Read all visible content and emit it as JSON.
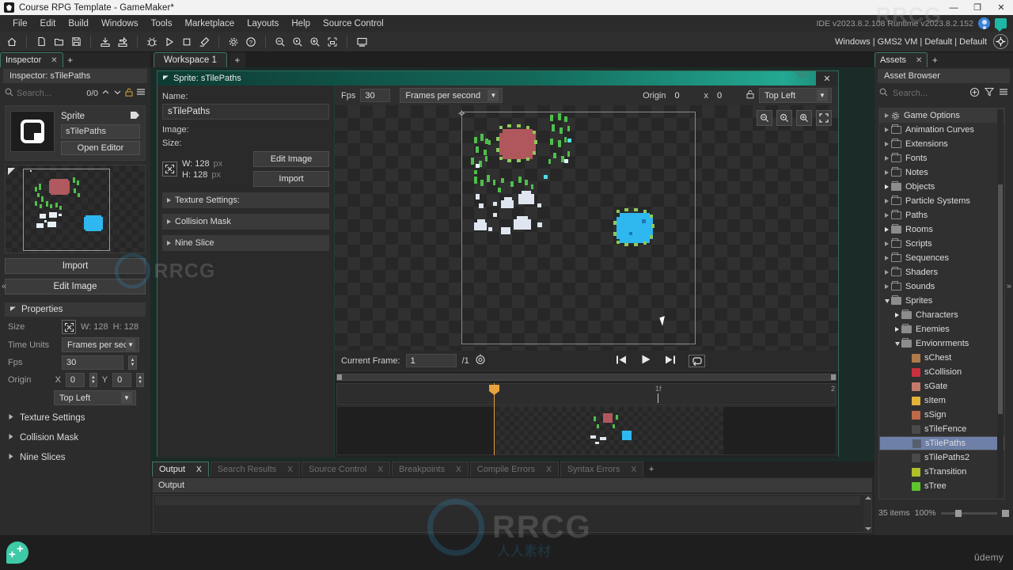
{
  "titlebar": {
    "title": "Course RPG Template - GameMaker*",
    "app_icon": "gamemaker-icon",
    "minimize": "—",
    "maximize": "❐",
    "close": "✕"
  },
  "menubar": {
    "items": [
      "File",
      "Edit",
      "Build",
      "Windows",
      "Tools",
      "Marketplace",
      "Layouts",
      "Help",
      "Source Control"
    ],
    "version_text": "IDE v2023.8.2.108  Runtime v2023.8.2.152"
  },
  "toolbar": {
    "icons": [
      "home-icon",
      "new-file-icon",
      "open-folder-icon",
      "save-icon",
      "build-icon",
      "build-run-icon",
      "debug-icon",
      "play-icon",
      "stop-icon",
      "clean-icon",
      "preferences-gear-icon",
      "help-icon",
      "zoom-out-icon",
      "zoom-reset-icon",
      "zoom-in-icon",
      "zoom-fit-icon",
      "display-icon"
    ],
    "target": "Windows | GMS2 VM | Default | Default",
    "target_button": "target-selector-icon"
  },
  "inspector": {
    "tab_label": "Inspector",
    "tab_close": "✕",
    "tab_add": "+",
    "panel_title": "Inspector: sTilePaths",
    "search_placeholder": "Search...",
    "match_count": "0/0",
    "up_icon": "chevron-up-icon",
    "down_icon": "chevron-down-icon",
    "lock_icon": "unlock-icon",
    "menu_icon": "hamburger-menu-icon",
    "card": {
      "type_label": "Sprite",
      "tag_icon": "tag-icon",
      "name_value": "sTilePaths",
      "open_editor_label": "Open Editor"
    },
    "import_label": "Import",
    "edit_image_label": "Edit Image",
    "properties": {
      "section_label": "Properties",
      "size_label": "Size",
      "size_icon": "resize-icon",
      "width_text": "W: 128",
      "height_text": "H: 128",
      "time_units_label": "Time Units",
      "time_units_value": "Frames per secon",
      "fps_label": "Fps",
      "fps_value": "30",
      "origin_label": "Origin",
      "origin_x_label": "X",
      "origin_x_value": "0",
      "origin_y_label": "Y",
      "origin_y_value": "0",
      "origin_preset": "Top Left"
    },
    "sections": [
      "Texture Settings",
      "Collision Mask",
      "Nine Slices"
    ],
    "collapse_icon": "«"
  },
  "workspace": {
    "tab_label": "Workspace 1",
    "tab_add": "+"
  },
  "sprite_editor": {
    "header_title": "Sprite: sTilePaths",
    "close_icon": "✕",
    "name_label": "Name:",
    "name_value": "sTilePaths",
    "image_label": "Image:",
    "size_label": "Size:",
    "size_icon": "resize-icon",
    "width_text": "W: 128",
    "height_text": "H: 128",
    "px_unit": "px",
    "edit_image_label": "Edit Image",
    "import_label": "Import",
    "accordions": [
      "Texture Settings:",
      "Collision Mask",
      "Nine Slice"
    ],
    "toolbar": {
      "fps_label": "Fps",
      "fps_value": "30",
      "time_units_value": "Frames per second",
      "origin_label": "Origin",
      "origin_x_value": "0",
      "origin_sep": "x",
      "origin_y_value": "0",
      "lock_icon": "unlock-icon",
      "origin_preset": "Top Left"
    },
    "canvas_tools": [
      "zoom-out-icon",
      "zoom-reset-icon",
      "zoom-in-icon",
      "fit-to-window-icon"
    ],
    "frame_bar": {
      "current_frame_label": "Current Frame:",
      "current_frame_value": "1",
      "total_frames": "/1",
      "onion_skin_icon": "onion-skin-icon",
      "first_frame_icon": "skip-back-icon",
      "play_icon": "play-icon",
      "last_frame_icon": "skip-forward-icon",
      "loop_icon": "loop-icon"
    },
    "timeline": {
      "tick_start": "0f",
      "tick_mid": "1f",
      "tick_end": "2"
    }
  },
  "output": {
    "tabs": [
      {
        "label": "Output",
        "active": true
      },
      {
        "label": "Search Results",
        "active": false
      },
      {
        "label": "Source Control",
        "active": false
      },
      {
        "label": "Breakpoints",
        "active": false
      },
      {
        "label": "Compile Errors",
        "active": false
      },
      {
        "label": "Syntax Errors",
        "active": false
      }
    ],
    "tab_close": "X",
    "tab_add": "+",
    "subtitle": "Output"
  },
  "assets": {
    "tab_label": "Assets",
    "tab_close": "✕",
    "tab_add": "+",
    "panel_title": "Asset Browser",
    "search_placeholder": "Search...",
    "add_icon": "add-circle-icon",
    "filter_icon": "filter-icon",
    "menu_icon": "hamburger-menu-icon",
    "tree": [
      {
        "label": "Game Options",
        "depth": 0,
        "arrow": "closed",
        "icon": "gear",
        "header": true
      },
      {
        "label": "Animation Curves",
        "depth": 0,
        "arrow": "closed",
        "icon": "folder"
      },
      {
        "label": "Extensions",
        "depth": 0,
        "arrow": "closed",
        "icon": "folder"
      },
      {
        "label": "Fonts",
        "depth": 0,
        "arrow": "closed",
        "icon": "folder"
      },
      {
        "label": "Notes",
        "depth": 0,
        "arrow": "closed",
        "icon": "folder"
      },
      {
        "label": "Objects",
        "depth": 0,
        "arrow": "closed-filled",
        "icon": "folder-full"
      },
      {
        "label": "Particle Systems",
        "depth": 0,
        "arrow": "closed",
        "icon": "folder"
      },
      {
        "label": "Paths",
        "depth": 0,
        "arrow": "closed",
        "icon": "folder"
      },
      {
        "label": "Rooms",
        "depth": 0,
        "arrow": "closed-filled",
        "icon": "folder-full"
      },
      {
        "label": "Scripts",
        "depth": 0,
        "arrow": "closed",
        "icon": "folder"
      },
      {
        "label": "Sequences",
        "depth": 0,
        "arrow": "closed",
        "icon": "folder"
      },
      {
        "label": "Shaders",
        "depth": 0,
        "arrow": "closed",
        "icon": "folder"
      },
      {
        "label": "Sounds",
        "depth": 0,
        "arrow": "closed",
        "icon": "folder"
      },
      {
        "label": "Sprites",
        "depth": 0,
        "arrow": "open",
        "icon": "folder-full"
      },
      {
        "label": "Characters",
        "depth": 1,
        "arrow": "closed-filled",
        "icon": "folder-full"
      },
      {
        "label": "Enemies",
        "depth": 1,
        "arrow": "closed-filled",
        "icon": "folder-full"
      },
      {
        "label": "Envionrments",
        "depth": 1,
        "arrow": "open",
        "icon": "folder-full"
      },
      {
        "label": "sChest",
        "depth": 2,
        "arrow": "none",
        "icon": "asset",
        "color": "#b07a4a"
      },
      {
        "label": "sCollision",
        "depth": 2,
        "arrow": "none",
        "icon": "asset",
        "color": "#c8303d"
      },
      {
        "label": "sGate",
        "depth": 2,
        "arrow": "none",
        "icon": "asset",
        "color": "#c27a6a"
      },
      {
        "label": "sItem",
        "depth": 2,
        "arrow": "none",
        "icon": "asset",
        "color": "#e0b33c"
      },
      {
        "label": "sSign",
        "depth": 2,
        "arrow": "none",
        "icon": "asset",
        "color": "#bc6a4a"
      },
      {
        "label": "sTileFence",
        "depth": 2,
        "arrow": "none",
        "icon": "asset",
        "color": "#4a4a4a"
      },
      {
        "label": "sTilePaths",
        "depth": 2,
        "arrow": "none",
        "icon": "asset",
        "color": "#555f6e",
        "selected": true
      },
      {
        "label": "sTilePaths2",
        "depth": 2,
        "arrow": "none",
        "icon": "asset",
        "color": "#4a4a4a"
      },
      {
        "label": "sTransition",
        "depth": 2,
        "arrow": "none",
        "icon": "asset",
        "color": "#b0bf2a"
      },
      {
        "label": "sTree",
        "depth": 2,
        "arrow": "none",
        "icon": "asset",
        "color": "#5ec32e"
      }
    ],
    "footer_count": "35 items",
    "footer_zoom": "100%",
    "collapse_icon": "»"
  },
  "bottombar": {
    "logo_icon": "gamemaker-logo-icon",
    "udemy_label": "ûdemy"
  },
  "watermarks": {
    "main": "RRCG",
    "sub": "人人素材",
    "corner": "RRCG"
  },
  "colors": {
    "accent_teal": "#23a892",
    "tab_border_green": "#3e7a63",
    "selection_blue": "#6e7fa8",
    "playhead_orange": "#e8a33d"
  }
}
